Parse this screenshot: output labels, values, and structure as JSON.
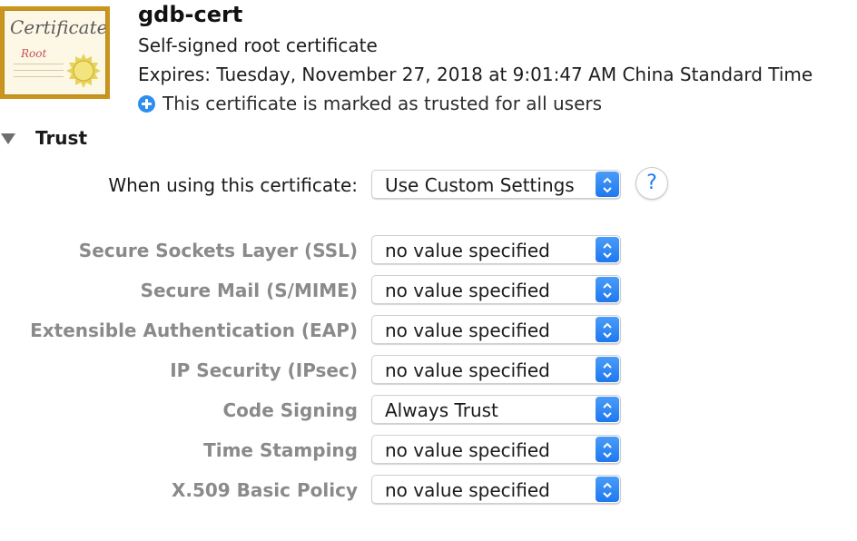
{
  "certificate": {
    "icon_text_main": "Certificate",
    "icon_text_sub": "Root",
    "name": "gdb-cert",
    "type": "Self-signed root certificate",
    "expires": "Expires: Tuesday, November 27, 2018 at 9:01:47 AM China Standard Time",
    "trust_status": "This certificate is marked as trusted for all users",
    "status_icon": "plus-circle-icon",
    "status_icon_color": "#2d8ef0"
  },
  "trust": {
    "section_title": "Trust",
    "when_using_label": "When using this certificate:",
    "when_using_value": "Use Custom Settings",
    "help_label": "?",
    "accent_color": "#1f78f0",
    "policies": [
      {
        "label": "Secure Sockets Layer (SSL)",
        "value": "no value specified"
      },
      {
        "label": "Secure Mail (S/MIME)",
        "value": "no value specified"
      },
      {
        "label": "Extensible Authentication (EAP)",
        "value": "no value specified"
      },
      {
        "label": "IP Security (IPsec)",
        "value": "no value specified"
      },
      {
        "label": "Code Signing",
        "value": "Always Trust"
      },
      {
        "label": "Time Stamping",
        "value": "no value specified"
      },
      {
        "label": "X.509 Basic Policy",
        "value": "no value specified"
      }
    ]
  }
}
